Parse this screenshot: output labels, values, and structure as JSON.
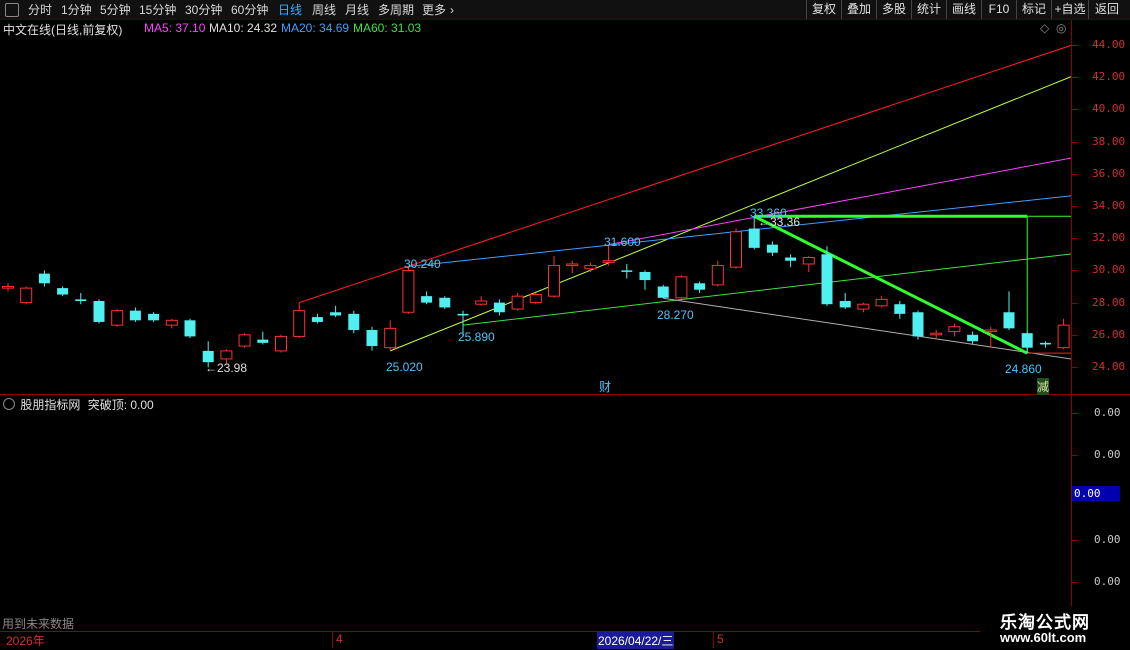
{
  "toolbar": {
    "periods": [
      "分时",
      "1分钟",
      "5分钟",
      "15分钟",
      "30分钟",
      "60分钟",
      "日线",
      "周线",
      "月线",
      "多周期",
      "更多"
    ],
    "active_period": "日线",
    "more_arrow": "›",
    "right_buttons": [
      "复权",
      "叠加",
      "多股",
      "统计",
      "画线",
      "F10",
      "标记",
      "+自选",
      "返回"
    ]
  },
  "main_panel": {
    "title": "中文在线(日线,前复权)",
    "ma": [
      {
        "label": "MA5:",
        "value": "37.10",
        "color": "#ff40ff"
      },
      {
        "label": "MA10:",
        "value": "24.32",
        "color": "#e0e0e0"
      },
      {
        "label": "MA20:",
        "value": "34.69",
        "color": "#3f9fff"
      },
      {
        "label": "MA60:",
        "value": "31.03",
        "color": "#40e040"
      }
    ],
    "y_ticks": [
      "44.00",
      "42.00",
      "40.00",
      "38.00",
      "36.00",
      "34.00",
      "32.00",
      "30.00",
      "28.00",
      "26.00",
      "24.00"
    ],
    "price_labels": [
      {
        "text": "←23.98",
        "color": "#e0e0e0"
      },
      {
        "text": "30.240",
        "color": "#4fc3f7"
      },
      {
        "text": "25.020",
        "color": "#4fc3f7"
      },
      {
        "text": "25.890",
        "color": "#4fc3f7"
      },
      {
        "text": "31.600",
        "color": "#4fc3f7"
      },
      {
        "text": "28.270",
        "color": "#4fc3f7"
      },
      {
        "text": "33.360",
        "color": "#4fc3f7"
      },
      {
        "text": "←33.36",
        "color": "#e0e0e0"
      },
      {
        "text": "24.860",
        "color": "#4fc3f7"
      }
    ],
    "markers": [
      {
        "text": "财",
        "color": "#4fc3f7"
      },
      {
        "text": "减",
        "color": "#e0e0a0"
      }
    ]
  },
  "sub_panel": {
    "title": "股朋指标网",
    "indicator": "突破顶: 0.00",
    "y_ticks": [
      "0.00",
      "0.00",
      "0.00",
      "0.00",
      "0.00"
    ],
    "current_value": "0.00",
    "footer_text": "用到未来数据"
  },
  "date_axis": {
    "year": "2026年",
    "month_4": "4",
    "cursor_date": "2026/04/22/三",
    "month_5": "5"
  },
  "watermark": {
    "title": "乐淘公式网",
    "url": "www.60lt.com"
  },
  "chart_data": {
    "type": "candlestick",
    "ylim": [
      23.0,
      44.8
    ],
    "candles": [
      {
        "o": 28.9,
        "c": 29.0,
        "h": 29.2,
        "l": 28.7,
        "up": true
      },
      {
        "o": 28.0,
        "c": 28.9,
        "h": 29.0,
        "l": 27.9,
        "up": true
      },
      {
        "o": 29.8,
        "c": 29.2,
        "h": 30.0,
        "l": 29.0,
        "up": false
      },
      {
        "o": 28.9,
        "c": 28.5,
        "h": 29.0,
        "l": 28.4,
        "up": false
      },
      {
        "o": 28.2,
        "c": 28.1,
        "h": 28.6,
        "l": 27.9,
        "up": false
      },
      {
        "o": 28.1,
        "c": 26.8,
        "h": 28.2,
        "l": 26.7,
        "up": false
      },
      {
        "o": 26.6,
        "c": 27.5,
        "h": 27.6,
        "l": 26.5,
        "up": true
      },
      {
        "o": 27.5,
        "c": 26.9,
        "h": 27.7,
        "l": 26.8,
        "up": false
      },
      {
        "o": 27.3,
        "c": 26.9,
        "h": 27.4,
        "l": 26.8,
        "up": false
      },
      {
        "o": 26.6,
        "c": 26.9,
        "h": 27.0,
        "l": 26.4,
        "up": true
      },
      {
        "o": 26.9,
        "c": 25.9,
        "h": 27.0,
        "l": 25.8,
        "up": false
      },
      {
        "o": 25.0,
        "c": 24.3,
        "h": 25.6,
        "l": 23.98,
        "up": false
      },
      {
        "o": 24.5,
        "c": 25.0,
        "h": 25.1,
        "l": 24.2,
        "up": true
      },
      {
        "o": 25.3,
        "c": 26.0,
        "h": 26.1,
        "l": 25.2,
        "up": true
      },
      {
        "o": 25.7,
        "c": 25.5,
        "h": 26.2,
        "l": 25.4,
        "up": false
      },
      {
        "o": 25.0,
        "c": 25.9,
        "h": 26.0,
        "l": 24.9,
        "up": true
      },
      {
        "o": 25.9,
        "c": 27.5,
        "h": 28.0,
        "l": 25.8,
        "up": true
      },
      {
        "o": 27.1,
        "c": 26.8,
        "h": 27.3,
        "l": 26.7,
        "up": false
      },
      {
        "o": 27.4,
        "c": 27.2,
        "h": 27.8,
        "l": 27.1,
        "up": false
      },
      {
        "o": 27.3,
        "c": 26.3,
        "h": 27.5,
        "l": 26.1,
        "up": false
      },
      {
        "o": 26.3,
        "c": 25.3,
        "h": 26.5,
        "l": 25.02,
        "up": false
      },
      {
        "o": 25.2,
        "c": 26.4,
        "h": 26.9,
        "l": 25.02,
        "up": true
      },
      {
        "o": 27.4,
        "c": 30.0,
        "h": 30.24,
        "l": 27.3,
        "up": true
      },
      {
        "o": 28.4,
        "c": 28.0,
        "h": 28.7,
        "l": 27.9,
        "up": false
      },
      {
        "o": 28.3,
        "c": 27.7,
        "h": 28.4,
        "l": 27.6,
        "up": false
      },
      {
        "o": 27.3,
        "c": 27.2,
        "h": 27.5,
        "l": 25.89,
        "up": false
      },
      {
        "o": 27.9,
        "c": 28.1,
        "h": 28.4,
        "l": 27.8,
        "up": true
      },
      {
        "o": 28.0,
        "c": 27.4,
        "h": 28.2,
        "l": 27.2,
        "up": false
      },
      {
        "o": 27.6,
        "c": 28.4,
        "h": 28.6,
        "l": 27.5,
        "up": true
      },
      {
        "o": 28.0,
        "c": 28.5,
        "h": 28.6,
        "l": 27.9,
        "up": true
      },
      {
        "o": 28.4,
        "c": 30.3,
        "h": 30.9,
        "l": 28.3,
        "up": true
      },
      {
        "o": 30.3,
        "c": 30.4,
        "h": 30.6,
        "l": 29.8,
        "up": true
      },
      {
        "o": 30.1,
        "c": 30.3,
        "h": 30.5,
        "l": 29.9,
        "up": true
      },
      {
        "o": 30.5,
        "c": 30.6,
        "h": 31.6,
        "l": 30.3,
        "up": true
      },
      {
        "o": 30.0,
        "c": 30.0,
        "h": 30.4,
        "l": 29.5,
        "up": false
      },
      {
        "o": 29.9,
        "c": 29.4,
        "h": 30.0,
        "l": 28.8,
        "up": false
      },
      {
        "o": 29.0,
        "c": 28.3,
        "h": 29.1,
        "l": 28.27,
        "up": false
      },
      {
        "o": 28.3,
        "c": 29.6,
        "h": 29.7,
        "l": 28.2,
        "up": true
      },
      {
        "o": 29.2,
        "c": 28.8,
        "h": 29.3,
        "l": 28.6,
        "up": false
      },
      {
        "o": 29.1,
        "c": 30.3,
        "h": 30.6,
        "l": 29.0,
        "up": true
      },
      {
        "o": 30.2,
        "c": 32.4,
        "h": 32.6,
        "l": 30.1,
        "up": true
      },
      {
        "o": 32.6,
        "c": 31.4,
        "h": 33.36,
        "l": 31.3,
        "up": false
      },
      {
        "o": 31.6,
        "c": 31.1,
        "h": 31.8,
        "l": 30.9,
        "up": false
      },
      {
        "o": 30.8,
        "c": 30.6,
        "h": 31.0,
        "l": 30.2,
        "up": false
      },
      {
        "o": 30.4,
        "c": 30.8,
        "h": 30.9,
        "l": 29.9,
        "up": true
      },
      {
        "o": 31.0,
        "c": 27.9,
        "h": 31.5,
        "l": 27.8,
        "up": false
      },
      {
        "o": 28.1,
        "c": 27.7,
        "h": 28.6,
        "l": 27.6,
        "up": false
      },
      {
        "o": 27.6,
        "c": 27.9,
        "h": 28.0,
        "l": 27.4,
        "up": true
      },
      {
        "o": 27.8,
        "c": 28.2,
        "h": 28.4,
        "l": 27.7,
        "up": true
      },
      {
        "o": 27.9,
        "c": 27.3,
        "h": 28.1,
        "l": 27.0,
        "up": false
      },
      {
        "o": 27.4,
        "c": 25.9,
        "h": 27.5,
        "l": 25.7,
        "up": false
      },
      {
        "o": 26.0,
        "c": 26.1,
        "h": 26.3,
        "l": 25.8,
        "up": true
      },
      {
        "o": 26.2,
        "c": 26.5,
        "h": 26.7,
        "l": 25.9,
        "up": true
      },
      {
        "o": 26.0,
        "c": 25.6,
        "h": 26.2,
        "l": 25.4,
        "up": false
      },
      {
        "o": 26.3,
        "c": 26.2,
        "h": 26.5,
        "l": 25.2,
        "up": true
      },
      {
        "o": 27.4,
        "c": 26.4,
        "h": 28.7,
        "l": 26.3,
        "up": false
      },
      {
        "o": 26.1,
        "c": 25.2,
        "h": 26.2,
        "l": 24.86,
        "up": false
      },
      {
        "o": 25.5,
        "c": 25.4,
        "h": 25.6,
        "l": 25.2,
        "up": false
      },
      {
        "o": 25.2,
        "c": 26.6,
        "h": 27.0,
        "l": 25.1,
        "up": true
      },
      {
        "o": 26.5,
        "c": 25.7,
        "h": 26.7,
        "l": 25.6,
        "up": false
      }
    ],
    "trend_lines": [
      {
        "color": "#ff2020",
        "from": [
          16,
          28.0
        ],
        "to": [
          59,
          44.2
        ]
      },
      {
        "color": "#c0ff40",
        "from": [
          21,
          25.0
        ],
        "to": [
          59,
          42.3
        ]
      },
      {
        "color": "#ff40ff",
        "from": [
          33,
          31.6
        ],
        "to": [
          59,
          37.1
        ]
      },
      {
        "color": "#3f9fff",
        "from": [
          22,
          30.24
        ],
        "to": [
          59,
          34.7
        ]
      },
      {
        "color": "#40e040",
        "from": [
          25,
          26.6
        ],
        "to": [
          59,
          31.1
        ]
      },
      {
        "color": "#b0b0b0",
        "from": [
          36,
          28.27
        ],
        "to": [
          59,
          24.4
        ]
      },
      {
        "color": "#30ff30",
        "from": [
          41,
          33.36
        ],
        "to": [
          56,
          24.86
        ],
        "bold": true
      },
      {
        "color": "#30ff30",
        "from": [
          41,
          33.36
        ],
        "to": [
          56,
          33.36
        ],
        "bold": true
      },
      {
        "color": "#30ff30",
        "from": [
          56,
          33.36
        ],
        "to": [
          56,
          24.86
        ]
      },
      {
        "color": "#30ff30",
        "from": [
          56,
          33.36
        ],
        "to": [
          59,
          33.36
        ]
      },
      {
        "color": "#ff2020",
        "from": [
          56,
          24.86
        ],
        "to": [
          59,
          24.86
        ]
      }
    ]
  }
}
